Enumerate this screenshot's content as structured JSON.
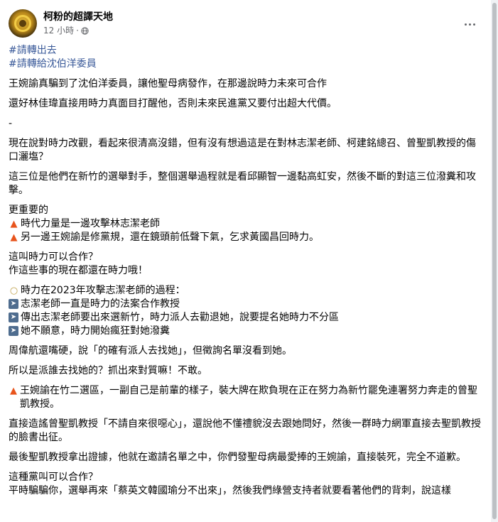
{
  "post": {
    "page_name": "柯粉的超譯天地",
    "time": "12 小時",
    "dot": "·",
    "hashtags": [
      "#請轉出去",
      "#請轉給沈伯洋委員"
    ]
  },
  "content": {
    "p1": "王婉諭真騙到了沈伯洋委員，讓他聖母病發作，在那邊說時力未來可合作",
    "p2": "還好林佳瑋直接用時力真面目打醒他，否則未來民進黨又要付出超大代價。",
    "sep": "-",
    "p3": "現在說對時力改觀，看起來很清高沒錯，但有沒有想過這是在對林志潔老師、柯建銘總召、曾聖凱教授的傷口灑塩？",
    "p4": "這三位是他們在新竹的選舉對手，整個選舉過程就是看邱顯智一邊黏高虹安，然後不斷的對這三位潑糞和攻擊。",
    "p5_title": "更重要的",
    "p5_l1": "時代力量是一邊攻擊林志潔老師",
    "p5_l2": "另一邊王婉諭是修黨規，還在鏡頭前低聲下氣，乞求黃國昌回時力。",
    "p6_l1": "這叫時力可以合作？",
    "p6_l2": "作這些事的現在都還在時力哦！",
    "p7_title": "時力在2023年攻擊志潔老師的過程：",
    "p7_items": [
      "志潔老師一直是時力的法案合作教授",
      "傳出志潔老師要出來選新竹，時力派人去勸退她，說要提名她時力不分區",
      "她不願意，時力開始瘋狂對她潑糞"
    ],
    "p8": "周偉航還嘴硬，說「的確有派人去找她」，但徵詢名單沒看到她。",
    "p9": "所以是派誰去找她的？抓出來對質嘛！不敢。",
    "p10": "王婉諭在竹二選區，一副自己是前輩的樣子，裝大牌在欺負現在正在努力為新竹罷免連署努力奔走的曾聖凱教授。",
    "p11": "直接造謠曾聖凱教授「不請自來很噁心」，還說他不懂禮貌沒去跟她問好，然後一群時力網軍直接去聖凱教授的臉書出征。",
    "p12": "最後聖凱教授拿出證據，他就在邀請名單之中，你們發聖母病最愛捧的王婉諭，直接裝死，完全不道歉。",
    "p13_l1": "這種黨叫可以合作？",
    "p13_l2": "平時騙騙你，選舉再來「蔡英文韓國瑜分不出來」，然後我們綠營支持者就要看著他們的背刺，說這樣"
  },
  "icons": {
    "fire": "fire-icon",
    "bulb": "lightbulb-icon",
    "arrow": "right-arrow-icon",
    "globe": "globe-icon",
    "more": "more-options-icon"
  },
  "colors": {
    "hashtag": "#385898",
    "secondary_text": "#65676b",
    "fire": "#e8541c",
    "arrow_bg": "#4f6d8f"
  }
}
